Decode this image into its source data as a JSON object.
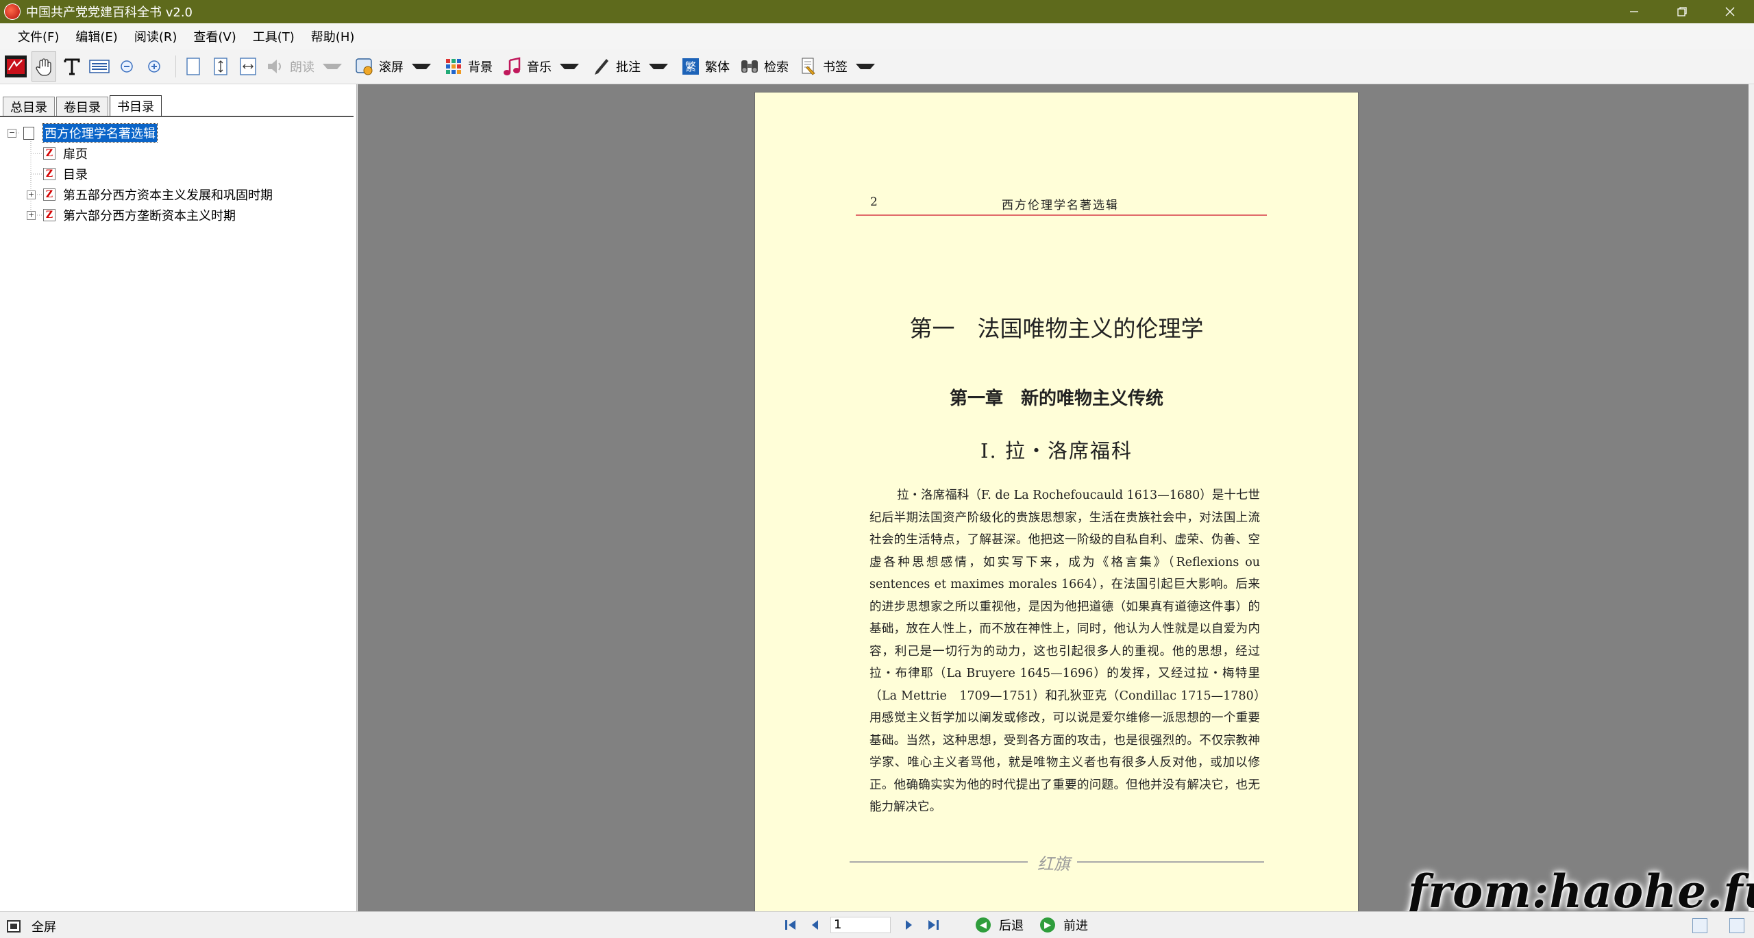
{
  "window": {
    "title": "中国共产党党建百科全书 v2.0"
  },
  "menu": [
    "文件(F)",
    "编辑(E)",
    "阅读(R)",
    "查看(V)",
    "工具(T)",
    "帮助(H)"
  ],
  "toolbar": {
    "read_aloud": "朗读",
    "scroll": "滚屏",
    "background": "背景",
    "music": "音乐",
    "annotate": "批注",
    "traditional": "繁体",
    "search": "检索",
    "bookmark": "书签"
  },
  "tabs": [
    "总目录",
    "卷目录",
    "书目录"
  ],
  "tree": {
    "root": "西方伦理学名著选辑",
    "items": [
      "扉页",
      "目录",
      "第五部分西方资本主义发展和巩固时期",
      "第六部分西方垄断资本主义时期"
    ]
  },
  "page": {
    "number": "2",
    "running_title": "西方伦理学名著选辑",
    "part_title": "第一　法国唯物主义的伦理学",
    "chapter_title": "第一章　新的唯物主义传统",
    "section_title": "Ⅰ. 拉・洛席福科",
    "body": "拉・洛席福科（F. de La Rochefoucauld 1613—1680）是十七世纪后半期法国资产阶级化的贵族思想家，生活在贵族社会中，对法国上流社会的生活特点，了解甚深。他把这一阶级的自私自利、虚荣、伪善、空虚各种思想感情，如实写下来，成为《格言集》（Reflexions ou sentences et maximes morales 1664），在法国引起巨大影响。后来的进步思想家之所以重视他，是因为他把道德（如果真有道德这件事）的基础，放在人性上，而不放在神性上，同时，他认为人性就是以自爱为内容，利己是一切行为的动力，这也引起很多人的重视。他的思想，经过拉・布律耶（La Bruyere 1645—1696）的发挥，又经过拉・梅特里（La Mettrie　1709—1751）和孔狄亚克（Condillac 1715—1780）用感觉主义哲学加以阐发或修改，可以说是爱尔维修一派思想的一个重要基础。当然，这种思想，受到各方面的攻击，也是很强烈的。不仅宗教神学家、唯心主义者骂他，就是唯物主义者也有很多人反对他，或加以修正。他确确实实为他的时代提出了重要的问题。但他并没有解决它，也无能力解决它。",
    "footer_mark": "红旗"
  },
  "watermark": "from:haohe.fun",
  "statusbar": {
    "fullscreen": "全屏",
    "page_input": "1",
    "back": "后退",
    "forward": "前进"
  }
}
